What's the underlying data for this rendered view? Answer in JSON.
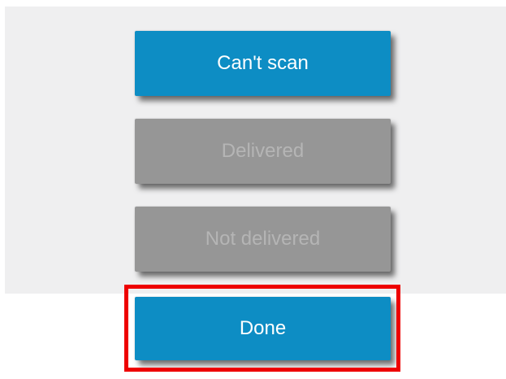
{
  "buttons": {
    "cant_scan": "Can't scan",
    "delivered": "Delivered",
    "not_delivered": "Not delivered",
    "done": "Done"
  },
  "colors": {
    "primary": "#0d8dc4",
    "disabled": "#969696",
    "disabled_text": "#b5b5b5",
    "highlight": "#ee0000",
    "panel_bg": "#efeff0"
  }
}
